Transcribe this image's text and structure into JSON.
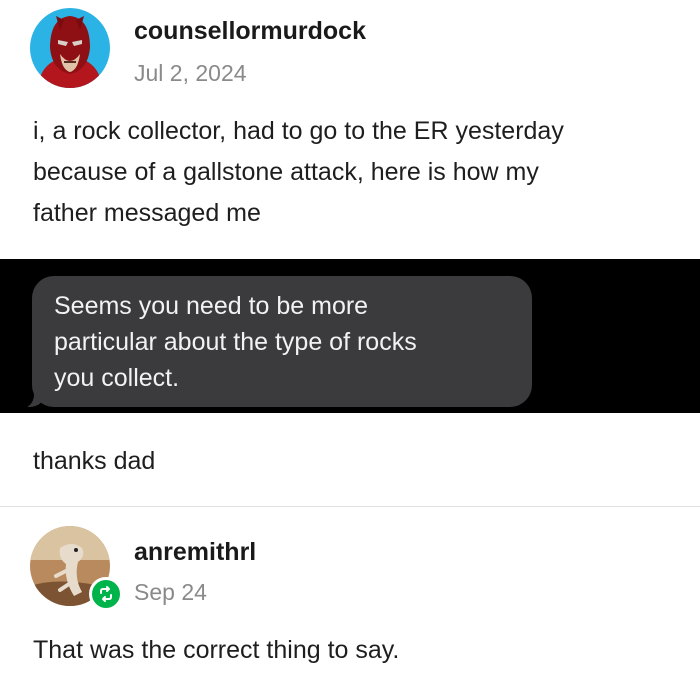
{
  "post": {
    "username": "counsellormurdock",
    "date": "Jul 2, 2024",
    "text_lines": [
      "i, a rock collector, had to go to the ER yesterday",
      "because of a gallstone attack, here is how my",
      "father messaged me"
    ],
    "screenshot_message_lines": [
      "Seems you need to be more",
      "particular about the type of rocks",
      "you collect."
    ],
    "followup": "thanks dad",
    "avatar_icon": "daredevil-avatar"
  },
  "reply": {
    "username": "anremithrl",
    "date": "Sep 24",
    "text": "That was the correct thing to say.",
    "avatar_icon": "lizard-avatar",
    "badge_icon": "reblog-icon",
    "badge_color": "#00b34a"
  }
}
